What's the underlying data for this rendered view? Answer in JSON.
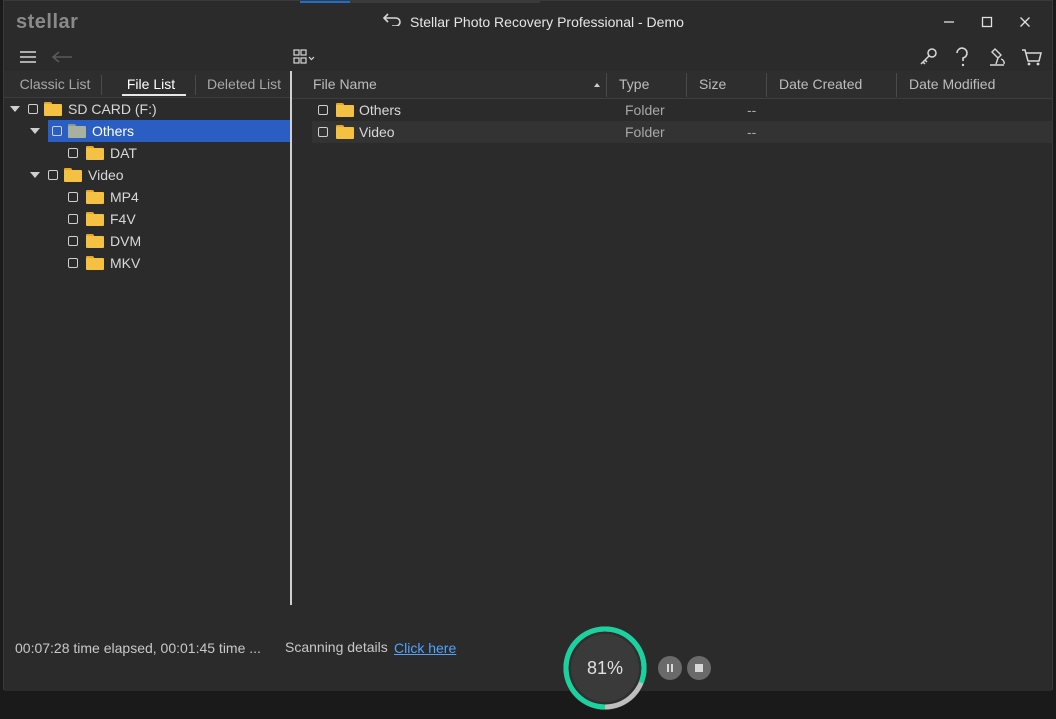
{
  "app": {
    "logo_text": "stellar",
    "title": "Stellar Photo Recovery Professional - Demo"
  },
  "tabs": [
    {
      "label": "Classic List",
      "active": false
    },
    {
      "label": "File List",
      "active": true
    },
    {
      "label": "Deleted List",
      "active": false
    }
  ],
  "tree": {
    "root": {
      "label": "SD CARD (F:)"
    },
    "others": {
      "label": "Others",
      "selected": true,
      "children": [
        {
          "label": "DAT"
        }
      ]
    },
    "video": {
      "label": "Video",
      "children": [
        {
          "label": "MP4"
        },
        {
          "label": "F4V"
        },
        {
          "label": "DVM"
        },
        {
          "label": "MKV"
        }
      ]
    }
  },
  "columns": {
    "file_name": "File Name",
    "type": "Type",
    "size": "Size",
    "date_created": "Date Created",
    "date_modified": "Date Modified"
  },
  "files": [
    {
      "name": "Others",
      "type": "Folder",
      "size": "--",
      "created": "",
      "modified": ""
    },
    {
      "name": "Video",
      "type": "Folder",
      "size": "--",
      "created": "",
      "modified": ""
    }
  ],
  "status": {
    "time_text": "00:07:28 time elapsed, 00:01:45 time ...",
    "scan_label": "Scanning details",
    "scan_link": "Click here",
    "progress_text": "81%",
    "progress_fraction": 0.81
  },
  "colors": {
    "accent_blue": "#2a5ec3",
    "progress_green": "#17d3a0",
    "link_blue": "#4ea3ff",
    "folder_yellow": "#f5c142"
  },
  "icons": [
    "menu-icon",
    "back-arrow-icon",
    "grid-view-icon",
    "key-icon",
    "help-icon",
    "scan-icon",
    "cart-icon",
    "undo-icon",
    "minimize-icon",
    "maximize-icon",
    "close-icon",
    "pause-icon",
    "stop-icon"
  ]
}
